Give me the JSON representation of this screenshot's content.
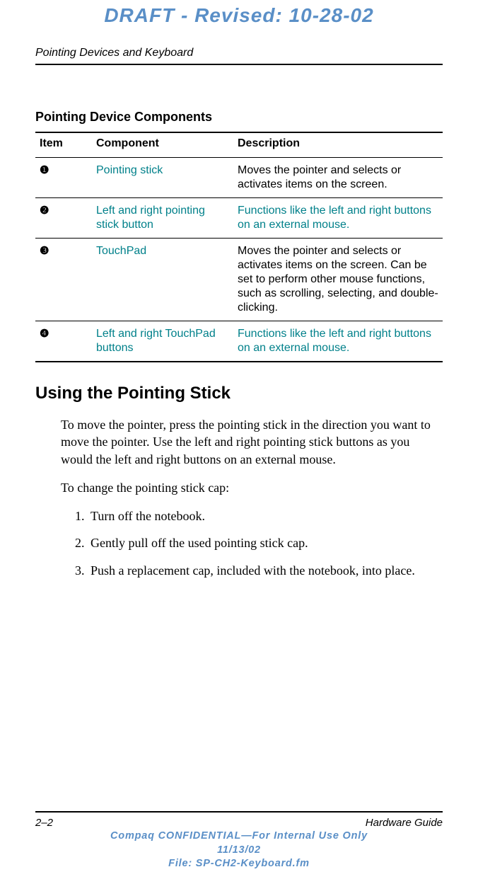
{
  "watermark": "DRAFT - Revised: 10-28-02",
  "running_head": "Pointing Devices and Keyboard",
  "table": {
    "title": "Pointing Device Components",
    "headers": {
      "item": "Item",
      "component": "Component",
      "description": "Description"
    },
    "rows": [
      {
        "item": "1",
        "component": "Pointing stick",
        "description": "Moves the pointer and selects or activates items on the screen."
      },
      {
        "item": "2",
        "component": "Left and right pointing stick button",
        "description": "Functions like the left and right buttons on an external mouse."
      },
      {
        "item": "3",
        "component": "TouchPad",
        "description": "Moves the pointer and selects or activates items on the screen. Can be set to perform other mouse functions, such as scrolling, selecting, and double-clicking."
      },
      {
        "item": "4",
        "component": "Left and right TouchPad buttons",
        "description": "Functions like the left and right buttons on an external mouse."
      }
    ]
  },
  "section": {
    "heading": "Using the Pointing Stick",
    "para1": "To move the pointer, press the pointing stick in the direction you want to move the pointer. Use the left and right pointing stick buttons as you would the left and right buttons on an external mouse.",
    "para2": "To change the pointing stick cap:",
    "steps": [
      "Turn off the notebook.",
      "Gently pull off the used pointing stick cap.",
      "Push a replacement cap, included with the notebook, into place."
    ]
  },
  "footer": {
    "page": "2–2",
    "guide": "Hardware Guide",
    "conf1": "Compaq CONFIDENTIAL—For Internal Use Only",
    "conf2": "11/13/02",
    "conf3": "File: SP-CH2-Keyboard.fm"
  }
}
